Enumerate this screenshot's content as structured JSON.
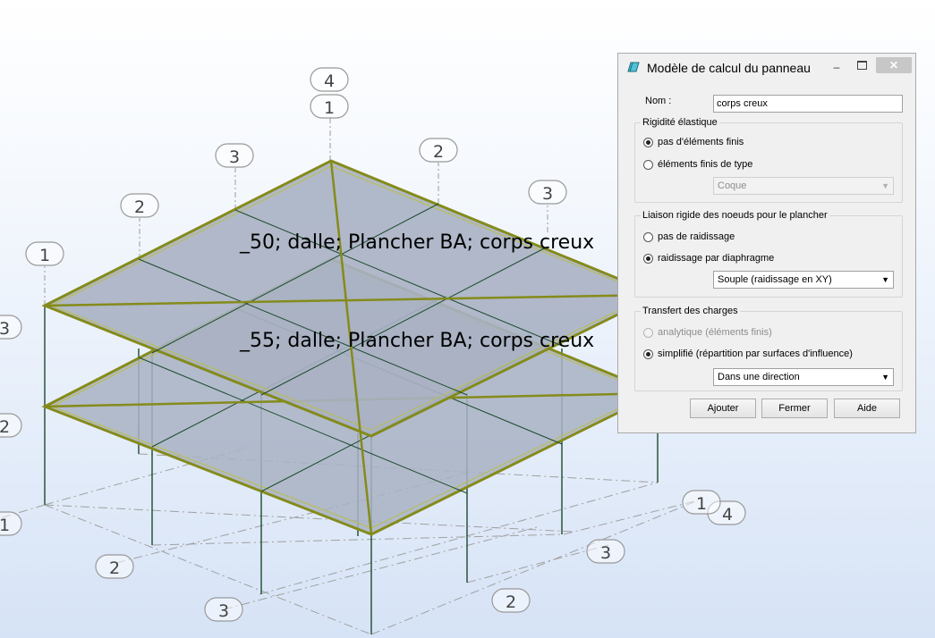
{
  "model": {
    "slabs": [
      {
        "label": "_50; dalle; Plancher BA; corps creux"
      },
      {
        "label": "_55; dalle; Plancher BA; corps creux"
      }
    ],
    "axis_labels": [
      "4",
      "1",
      "3",
      "2",
      "2",
      "3",
      "1",
      "3",
      "2",
      "1",
      "2",
      "3",
      "3",
      "2",
      "4",
      "1"
    ]
  },
  "dialog": {
    "title": "Modèle de calcul du panneau",
    "icon": "panel-eraser-icon",
    "window_buttons": {
      "minimize": "–",
      "maximize": "□",
      "close": "✕"
    },
    "nom": {
      "label": "Nom  :",
      "value": "corps creux"
    },
    "rigidite": {
      "title": "Rigidité élastique",
      "options": [
        "pas d'éléments finis",
        "éléments finis de type"
      ],
      "selected": 0,
      "type_select": "Coque"
    },
    "liaison": {
      "title": "Liaison rigide des noeuds pour le plancher",
      "options": [
        "pas de raidissage",
        "raidissage par diaphragme"
      ],
      "selected": 1,
      "select": "Souple (raidissage en XY)"
    },
    "transfert": {
      "title": "Transfert des charges",
      "options": [
        "analytique (éléments finis)",
        "simplifié (répartition par surfaces d'influence)"
      ],
      "selected": 1,
      "select": "Dans une direction"
    },
    "buttons": {
      "add": "Ajouter",
      "close": "Fermer",
      "help": "Aide"
    }
  },
  "colors": {
    "slab_fill": "#a8b1c3",
    "slab_edge": "#858b1a",
    "beam_line": "#1d4a2e",
    "axis_line": "#9a9a9a"
  }
}
